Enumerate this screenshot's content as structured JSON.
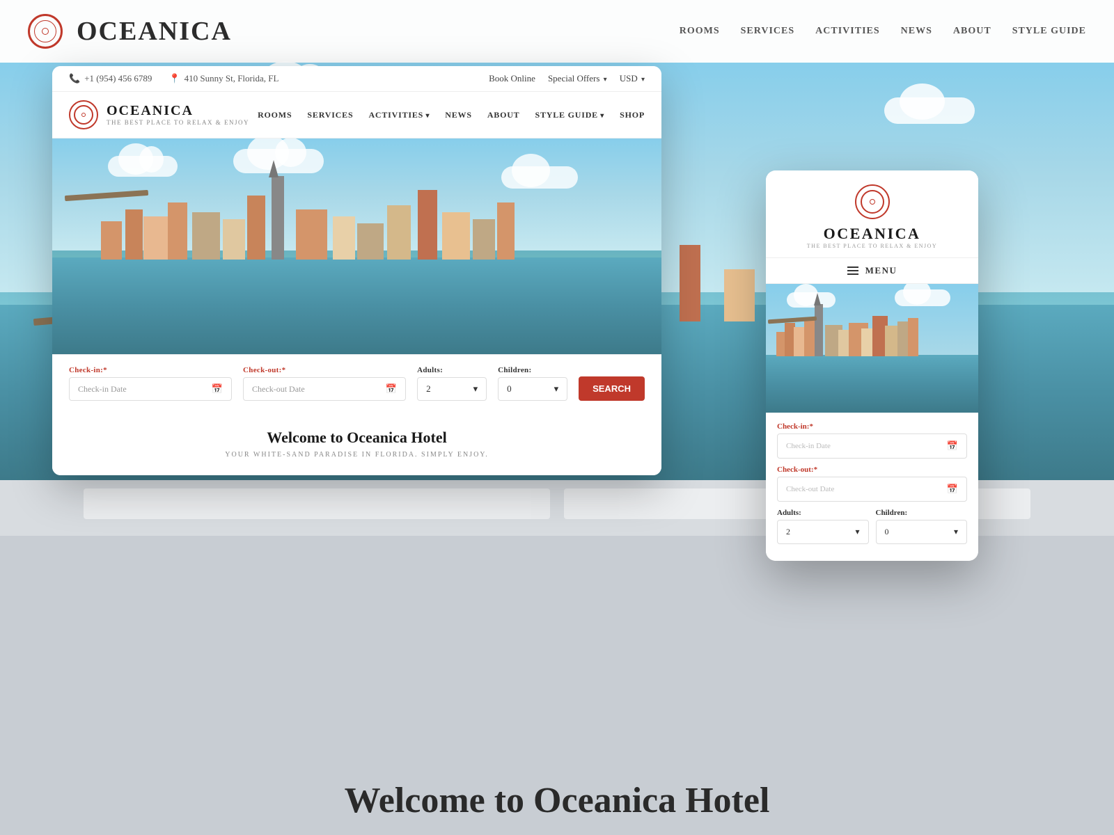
{
  "brand": {
    "name": "OCEANICA",
    "tagline": "THE BEST PLACE TO RELAX & ENJOY"
  },
  "topbar": {
    "phone": "+1 (954) 456 6789",
    "address": "410 Sunny St, Florida, FL",
    "book_online": "Book Online",
    "special_offers": "Special Offers",
    "currency": "USD"
  },
  "nav": {
    "rooms": "ROOMS",
    "services": "SERVICES",
    "activities": "ACTIVITIES",
    "news": "NEWS",
    "about": "ABOUT",
    "style_guide": "STYLE GUIDE",
    "shop": "SHOP"
  },
  "bg_nav": {
    "rooms": "ROOMS",
    "services": "SERVICES",
    "activities": "AcTivITIES",
    "news": "NEWS",
    "about": "ABOUT",
    "style_guide": "STYLE GUIDE"
  },
  "booking": {
    "checkin_label": "Check-in:",
    "checkin_placeholder": "Check-in Date",
    "checkout_label": "Check-out:",
    "checkout_placeholder": "Check-out Date",
    "adults_label": "Adults:",
    "adults_value": "2",
    "children_label": "Children:",
    "children_value": "0",
    "required_marker": "*",
    "search_btn": "SEARCH"
  },
  "welcome": {
    "title": "Welcome to Oceanica Hotel",
    "subtitle": "YOUR WHITE-SAND PARADISE IN FLORIDA. SIMPLY ENJOY."
  },
  "mobile": {
    "menu_label": "MENU",
    "checkin_label": "Check-in:",
    "checkin_placeholder": "Check-in Date",
    "checkout_label": "Check-out:",
    "checkout_placeholder": "Check-out Date",
    "adults_label": "Adults:",
    "adults_value": "2",
    "children_label": "Children:",
    "children_value": "0",
    "required_marker": "*"
  },
  "bottom_welcome": "Welcome to Oceanica Hotel"
}
